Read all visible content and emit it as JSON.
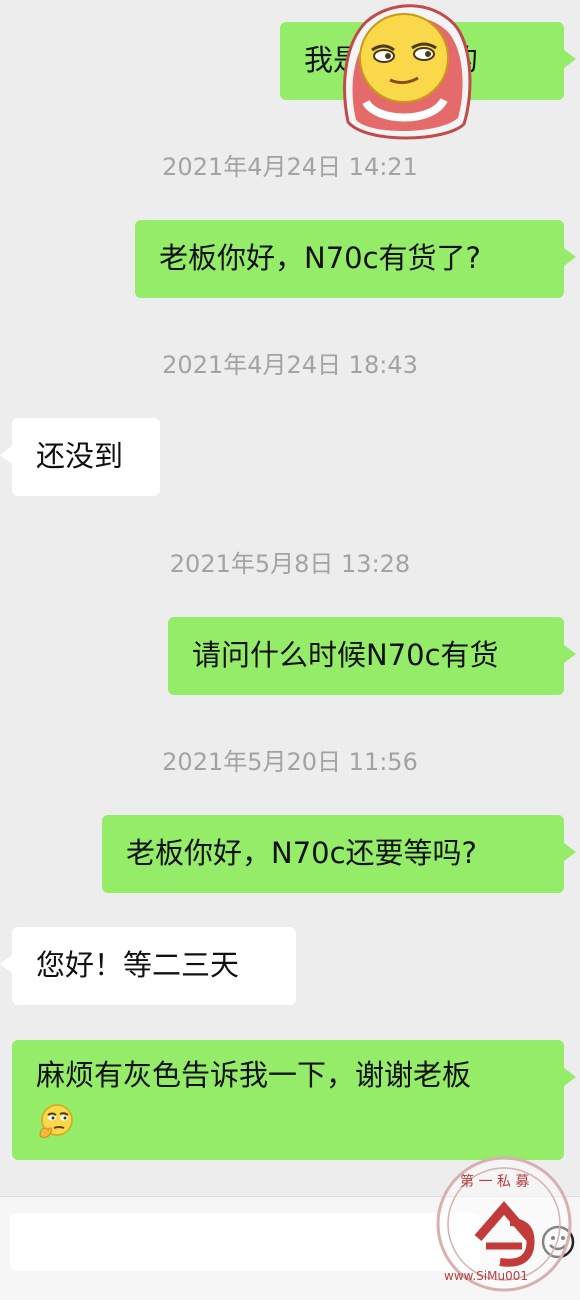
{
  "messages": [
    {
      "type": "out",
      "text": "我是从这边的"
    },
    {
      "type": "timestamp",
      "text": "2021年4月24日 14:21"
    },
    {
      "type": "out",
      "text": "老板你好，N70c有货了?"
    },
    {
      "type": "timestamp",
      "text": "2021年4月24日 18:43"
    },
    {
      "type": "in",
      "text": "还没到"
    },
    {
      "type": "timestamp",
      "text": "2021年5月8日 13:28"
    },
    {
      "type": "out",
      "text": "请问什么时候N70c有货"
    },
    {
      "type": "timestamp",
      "text": "2021年5月20日 11:56"
    },
    {
      "type": "out",
      "text": "老板你好，N70c还要等吗?"
    },
    {
      "type": "in",
      "text": "您好！等二三天"
    },
    {
      "type": "out",
      "text": "麻烦有灰色告诉我一下，谢谢老板"
    }
  ],
  "watermark": {
    "top_text": "第 一 私 募",
    "url_text": "www.SiMu001"
  },
  "colors": {
    "outgoing_bubble": "#95ec69",
    "incoming_bubble": "#ffffff",
    "background": "#ededed",
    "timestamp": "#a3a3a3"
  },
  "icons": [
    "sticker-emoji-icon",
    "thinking-emoji-icon",
    "smiley-icon",
    "watermark-logo-icon"
  ]
}
